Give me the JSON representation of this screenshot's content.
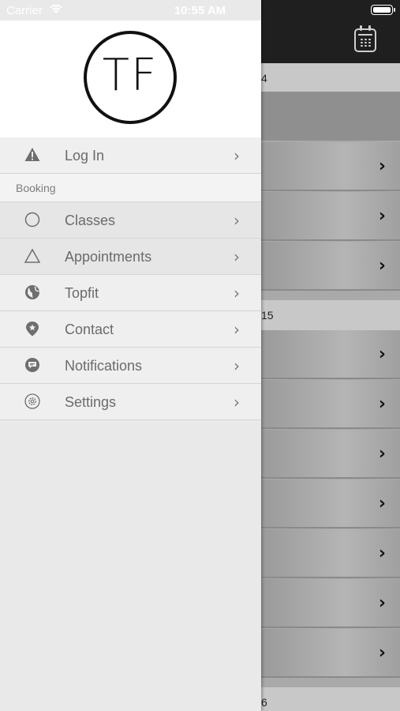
{
  "status_bar": {
    "carrier": "Carrier",
    "time": "10:55 AM"
  },
  "background": {
    "date_headers": [
      "4",
      "15",
      "6"
    ],
    "calendar_icon": "calendar-icon"
  },
  "drawer": {
    "logo_text": "TF",
    "top_items": [
      {
        "label": "Log In",
        "icon": "warning-icon"
      }
    ],
    "section_label": "Booking",
    "items": [
      {
        "label": "Classes",
        "icon": "circle-icon"
      },
      {
        "label": "Appointments",
        "icon": "triangle-icon"
      },
      {
        "label": "Topfit",
        "icon": "globe-icon"
      },
      {
        "label": "Contact",
        "icon": "location-pin-icon"
      },
      {
        "label": "Notifications",
        "icon": "chat-bubble-icon"
      },
      {
        "label": "Settings",
        "icon": "gear-icon"
      }
    ],
    "chevron": "›"
  }
}
